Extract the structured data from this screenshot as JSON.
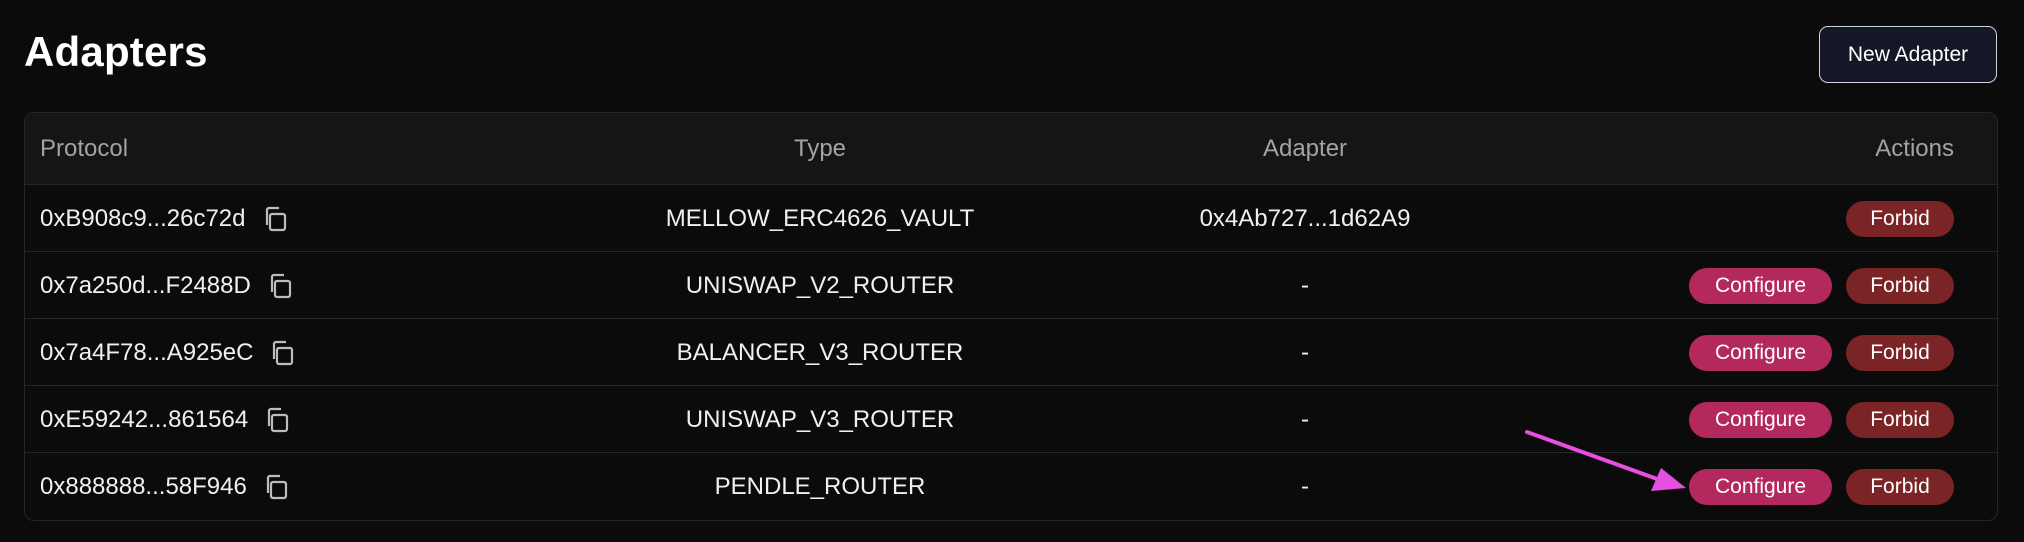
{
  "header": {
    "title": "Adapters",
    "new_button_label": "New Adapter"
  },
  "table": {
    "columns": {
      "protocol": "Protocol",
      "type": "Type",
      "adapter": "Adapter",
      "actions": "Actions"
    },
    "rows": [
      {
        "protocol": "0xB908c9...26c72d",
        "type": "MELLOW_ERC4626_VAULT",
        "adapter": "0x4Ab727...1d62A9",
        "configure": "",
        "forbid": "Forbid"
      },
      {
        "protocol": "0x7a250d...F2488D",
        "type": "UNISWAP_V2_ROUTER",
        "adapter": "-",
        "configure": "Configure",
        "forbid": "Forbid"
      },
      {
        "protocol": "0x7a4F78...A925eC",
        "type": "BALANCER_V3_ROUTER",
        "adapter": "-",
        "configure": "Configure",
        "forbid": "Forbid"
      },
      {
        "protocol": "0xE59242...861564",
        "type": "UNISWAP_V3_ROUTER",
        "adapter": "-",
        "configure": "Configure",
        "forbid": "Forbid"
      },
      {
        "protocol": "0x888888...58F946",
        "type": "PENDLE_ROUTER",
        "adapter": "-",
        "configure": "Configure",
        "forbid": "Forbid"
      }
    ]
  },
  "icons": {
    "copy": "copy-icon",
    "annotation": "arrow-annotation"
  },
  "colors": {
    "background": "#0b0b0b",
    "configure": "#b3295e",
    "forbid": "#7a2426",
    "arrow": "#e64fe0"
  }
}
